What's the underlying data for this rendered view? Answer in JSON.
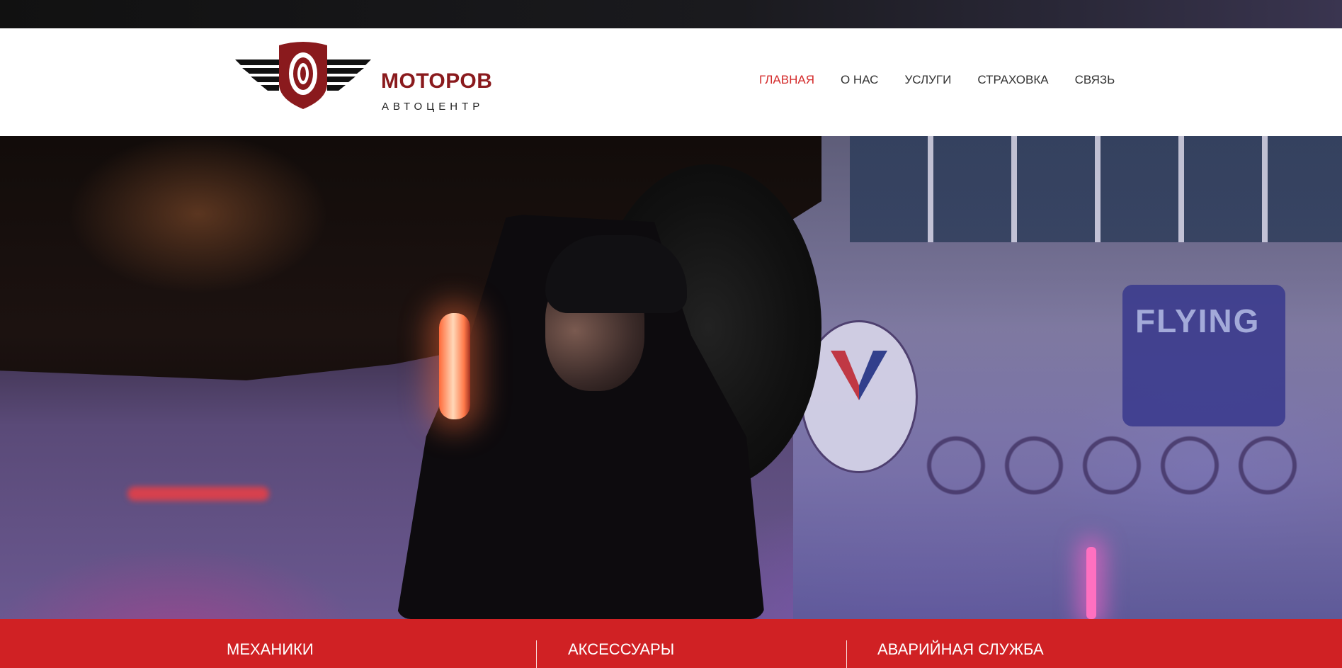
{
  "brand": {
    "name": "МОТОРОВ",
    "subtitle": "АВТОЦЕНТР",
    "accent_color": "#8a1a1d"
  },
  "nav": {
    "active_color": "#d42b2b",
    "items": [
      {
        "label": "ГЛАВНАЯ",
        "active": true
      },
      {
        "label": "О НАС",
        "active": false
      },
      {
        "label": "УСЛУГИ",
        "active": false
      },
      {
        "label": "СТРАХОВКА",
        "active": false
      },
      {
        "label": "СВЯЗЬ",
        "active": false
      }
    ]
  },
  "hero": {
    "sign_text": "FLYING"
  },
  "features": {
    "bar_color": "#d02124",
    "items": [
      {
        "label": "МЕХАНИКИ"
      },
      {
        "label": "АКСЕССУАРЫ"
      },
      {
        "label": "АВАРИЙНАЯ СЛУЖБА"
      }
    ]
  }
}
